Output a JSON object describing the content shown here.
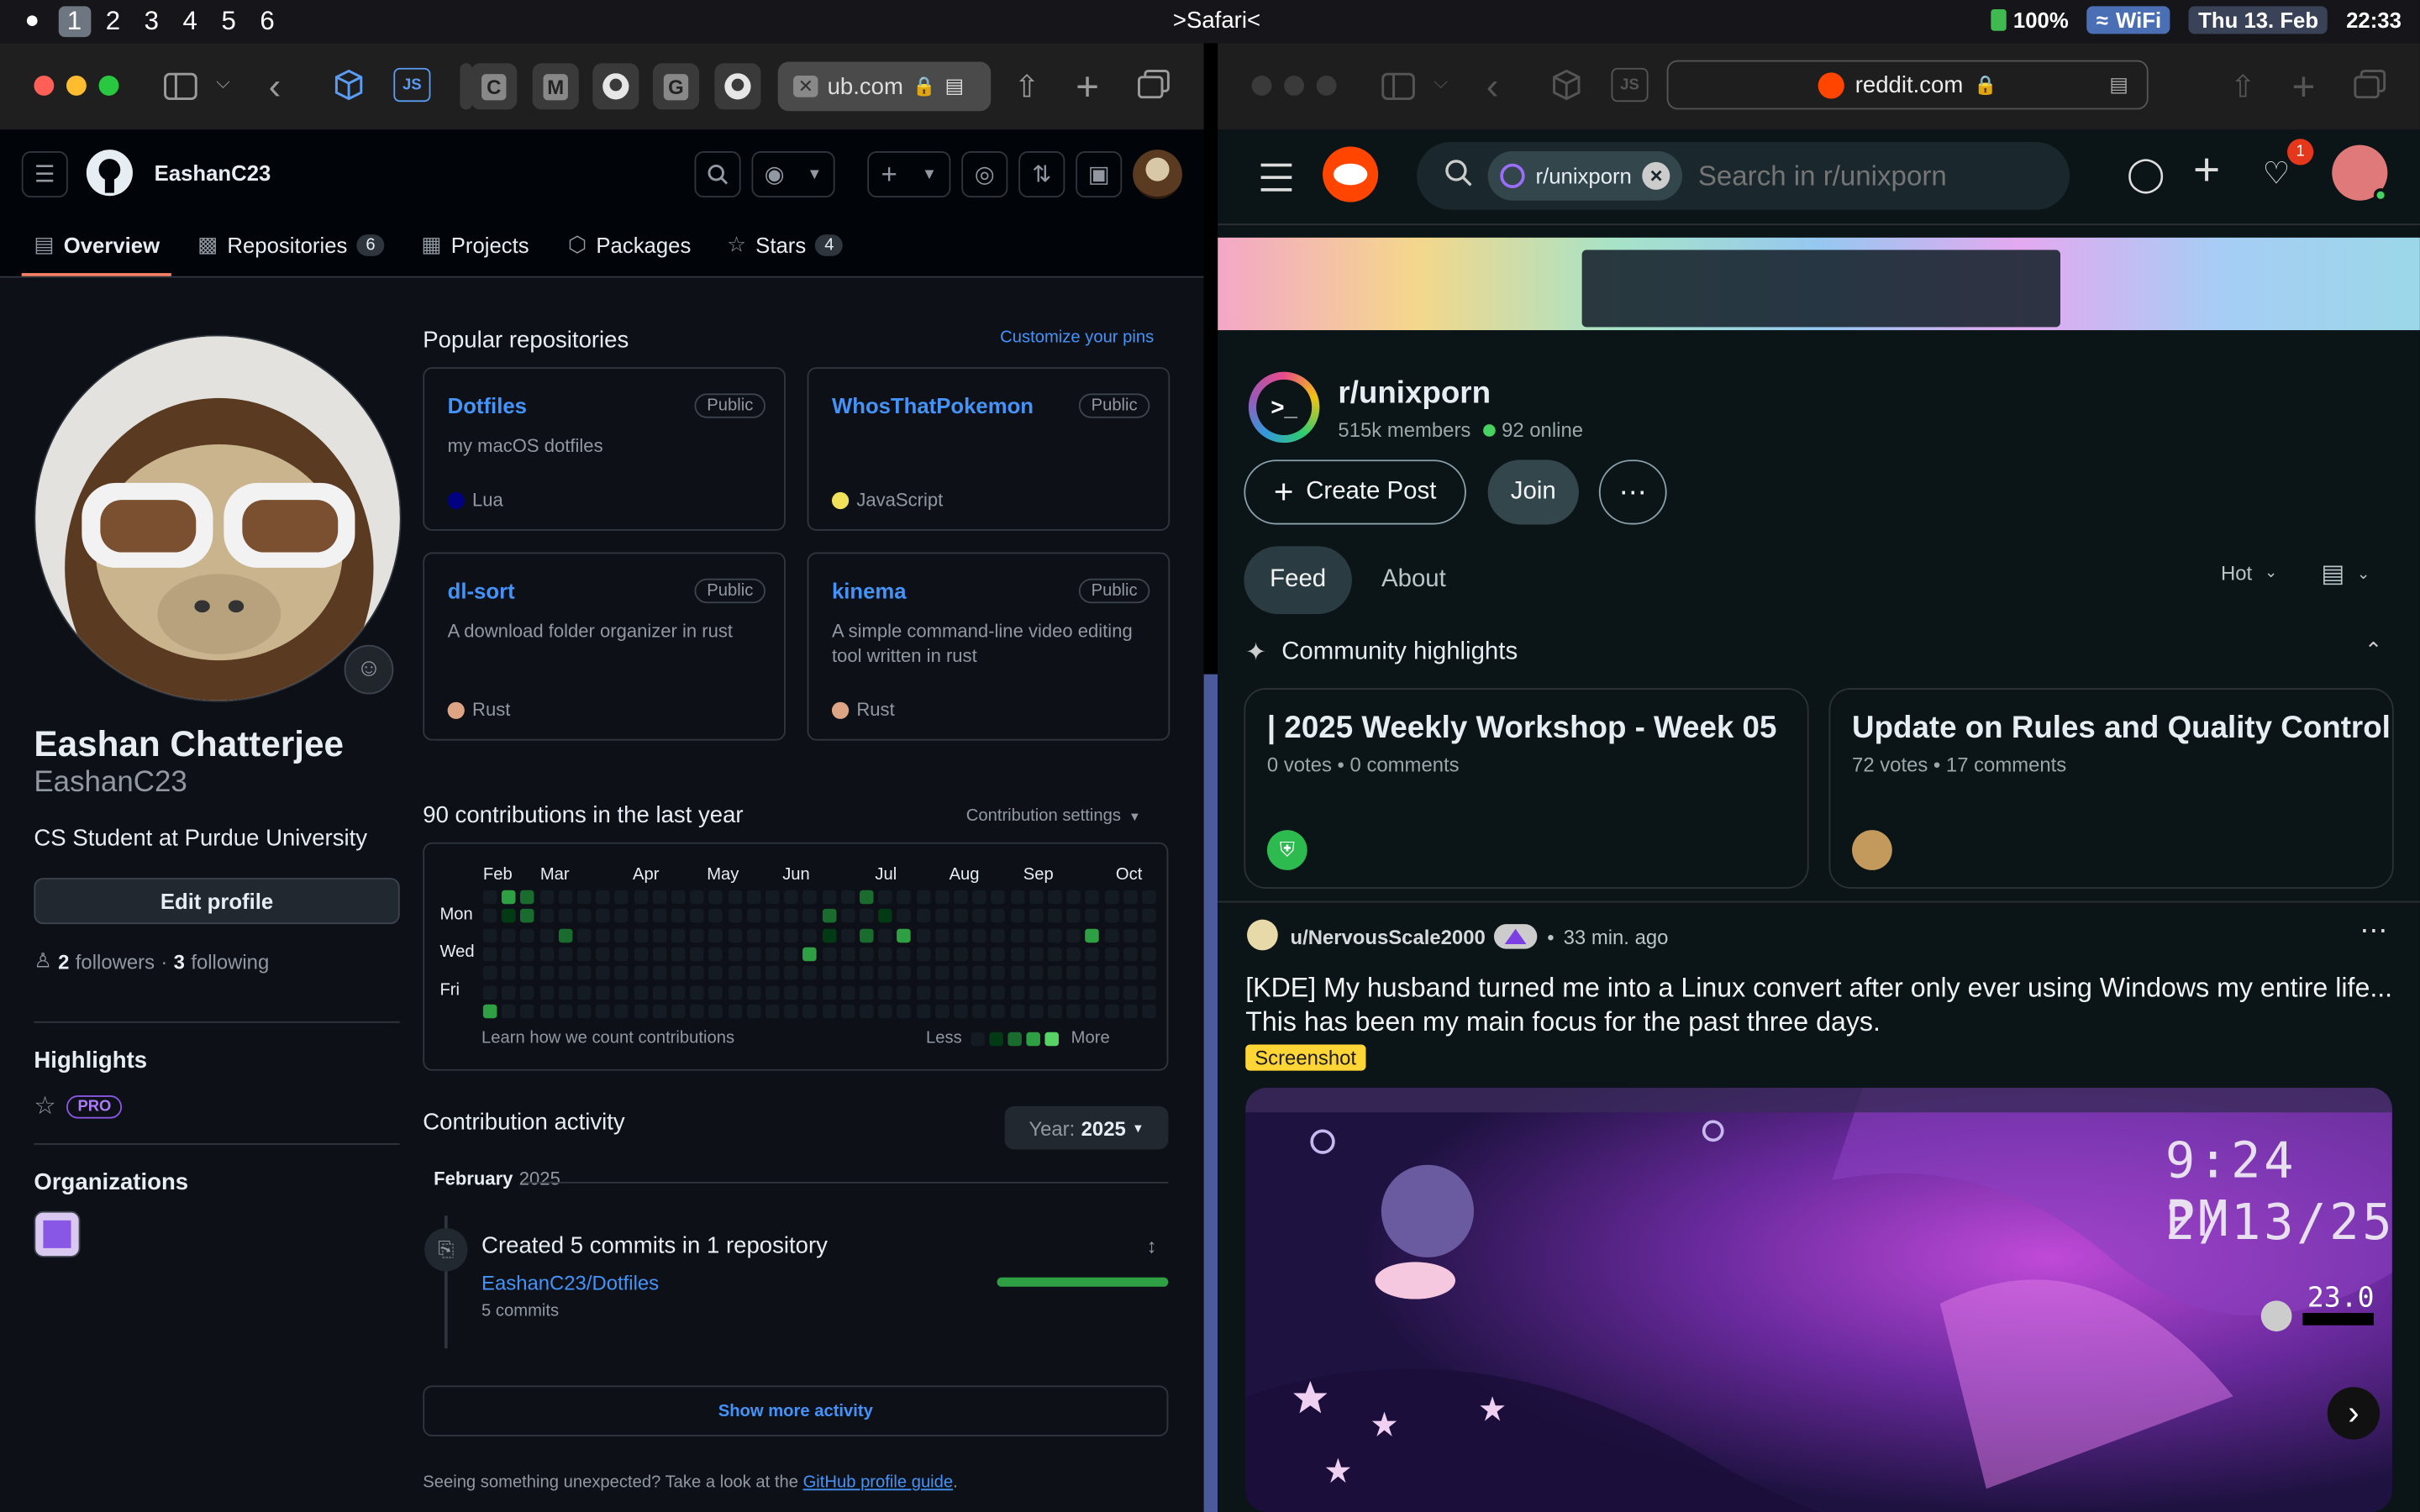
{
  "menubar": {
    "workspaces": [
      "1",
      "2",
      "3",
      "4",
      "5",
      "6"
    ],
    "app_title": ">Safari<",
    "battery": "100%",
    "wifi": "WiFi",
    "date": "Thu 13. Feb",
    "time": "22:33"
  },
  "github": {
    "address": "ub.com",
    "tabs": [
      "C",
      "M",
      "G"
    ],
    "username": "EashanC23",
    "nav": [
      {
        "label": "Overview",
        "count": ""
      },
      {
        "label": "Repositories",
        "count": "6"
      },
      {
        "label": "Projects",
        "count": ""
      },
      {
        "label": "Packages",
        "count": ""
      },
      {
        "label": "Stars",
        "count": "4"
      }
    ],
    "profile": {
      "name": "Eashan Chatterjee",
      "login": "EashanC23",
      "bio": "CS Student at Purdue University",
      "edit_label": "Edit profile",
      "followers_count": "2",
      "followers_label": "followers",
      "following_count": "3",
      "following_label": "following",
      "highlights_title": "Highlights",
      "pro_label": "PRO",
      "orgs_title": "Organizations"
    },
    "popular": {
      "title": "Popular repositories",
      "customize": "Customize your pins",
      "repos": [
        {
          "name": "Dotfiles",
          "visibility": "Public",
          "desc": "my macOS dotfiles",
          "lang": "Lua",
          "color": "#000080"
        },
        {
          "name": "WhosThatPokemon",
          "visibility": "Public",
          "desc": "",
          "lang": "JavaScript",
          "color": "#f1e05a"
        },
        {
          "name": "dl-sort",
          "visibility": "Public",
          "desc": "A download folder organizer in rust",
          "lang": "Rust",
          "color": "#dea584"
        },
        {
          "name": "kinema",
          "visibility": "Public",
          "desc": "A simple command-line video editing tool written in rust",
          "lang": "Rust",
          "color": "#dea584"
        }
      ]
    },
    "contrib": {
      "title": "90 contributions in the last year",
      "settings": "Contribution settings",
      "months": [
        "Feb",
        "Mar",
        "Apr",
        "May",
        "Jun",
        "Jul",
        "Aug",
        "Sep",
        "Oct"
      ],
      "days": [
        "Mon",
        "Wed",
        "Fri"
      ],
      "learn": "Learn how we count contributions",
      "less": "Less",
      "more": "More"
    },
    "activity": {
      "title": "Contribution activity",
      "year_label": "Year:",
      "year": "2025",
      "month": "February",
      "month_year": "2025",
      "event": "Created 5 commits in 1 repository",
      "repo": "EashanC23/Dotfiles",
      "commits": "5 commits",
      "progress": 1.0,
      "show_more": "Show more activity",
      "footer_text": "Seeing something unexpected? Take a look at the",
      "footer_link": "GitHub profile guide",
      "footer_end": "."
    }
  },
  "reddit": {
    "address": "reddit.com",
    "search_chip": "r/unixporn",
    "search_placeholder": "Search in r/unixporn",
    "notif_count": "1",
    "sub_name": "r/unixporn",
    "members": "515k members",
    "online": "92 online",
    "create_post": "Create Post",
    "join": "Join",
    "tabs": [
      "Feed",
      "About"
    ],
    "sort": "Hot",
    "highlights_title": "Community highlights",
    "highlights": [
      {
        "title": "| 2025 Weekly Workshop - Week 05",
        "meta": "0 votes • 0 comments"
      },
      {
        "title": "Update on Rules and Quality Control",
        "meta": "72 votes • 17 comments"
      }
    ],
    "post": {
      "author": "u/NervousScale2000",
      "time": "33 min. ago",
      "title": "[KDE] My husband turned me into a Linux convert after only ever using Windows my entire life... This has been my main focus for the past three days.",
      "flair": "Screenshot",
      "clock": "9:24 PM",
      "date": "2/13/25",
      "temp": "23.0"
    }
  }
}
